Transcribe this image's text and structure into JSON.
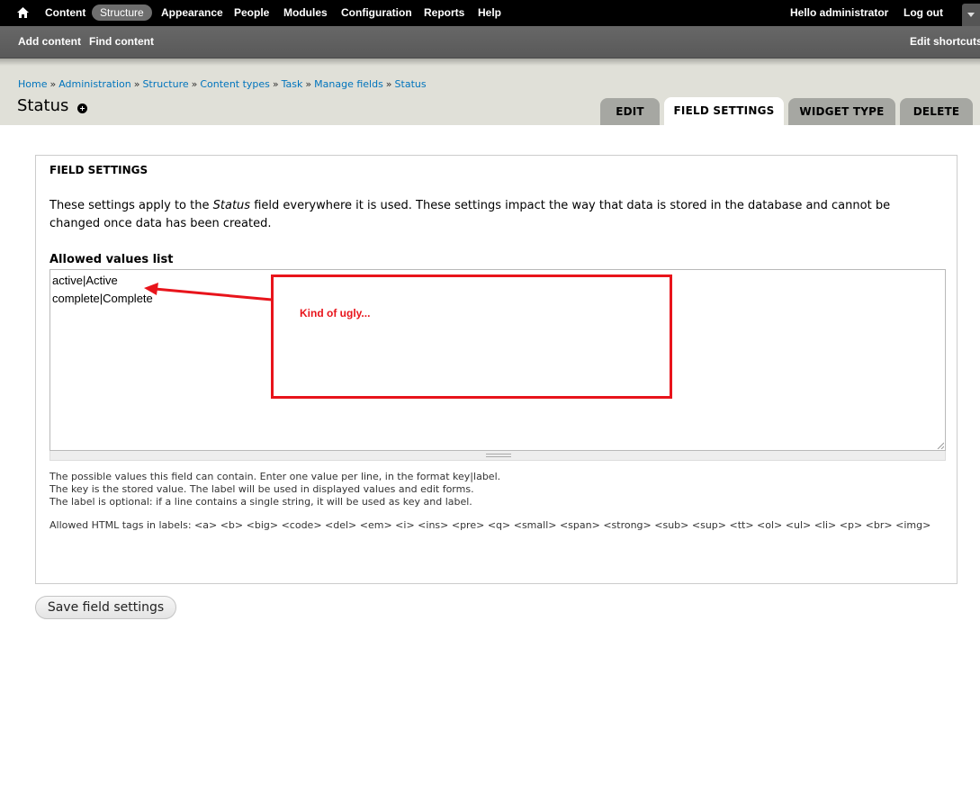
{
  "toolbar": {
    "menu": [
      "Content",
      "Structure",
      "Appearance",
      "People",
      "Modules",
      "Configuration",
      "Reports",
      "Help"
    ],
    "active_item": "Structure",
    "greeting_prefix": "Hello ",
    "greeting_user": "administrator",
    "logout": "Log out"
  },
  "shortcuts": {
    "add_content": "Add content",
    "find_content": "Find content",
    "edit_shortcuts": "Edit shortcuts"
  },
  "breadcrumb": [
    "Home",
    "Administration",
    "Structure",
    "Content types",
    "Task",
    "Manage fields",
    "Status"
  ],
  "breadcrumb_separator": "»",
  "page_title": "Status",
  "tabs": [
    {
      "label": "EDIT",
      "active": false
    },
    {
      "label": "FIELD SETTINGS",
      "active": true
    },
    {
      "label": "WIDGET TYPE",
      "active": false
    },
    {
      "label": "DELETE",
      "active": false
    }
  ],
  "fieldset": {
    "legend": "FIELD SETTINGS",
    "description_before": "These settings apply to the ",
    "description_field": "Status",
    "description_after": " field everywhere it is used. These settings impact the way that data is stored in the database and cannot be changed once data has been created.",
    "allowed_values_label": "Allowed values list",
    "allowed_values_lines": [
      "active|Active",
      "complete|Complete"
    ],
    "help_lines": [
      "The possible values this field can contain. Enter one value per line, in the format key|label.",
      "The key is the stored value. The label will be used in displayed values and edit forms.",
      "The label is optional: if a line contains a single string, it will be used as key and label."
    ],
    "allowed_html": "Allowed HTML tags in labels: <a> <b> <big> <code> <del> <em> <i> <ins> <pre> <q> <small> <span> <strong> <sub> <sup> <tt> <ol> <ul> <li> <p> <br> <img>"
  },
  "save_button": "Save field settings",
  "annotation": {
    "text": "Kind of ugly...",
    "color": "#e8141b"
  },
  "colors": {
    "toolbar_bg": "#000000",
    "shortcuts_bg": "#5f5f5f",
    "header_bg": "#e0e0d8",
    "link": "#0074bd",
    "tab_inactive": "#a6a7a2"
  },
  "icons": {
    "home": "home-icon",
    "shortcut_add": "plus-circle-icon",
    "toggle": "chevron-down-icon"
  }
}
